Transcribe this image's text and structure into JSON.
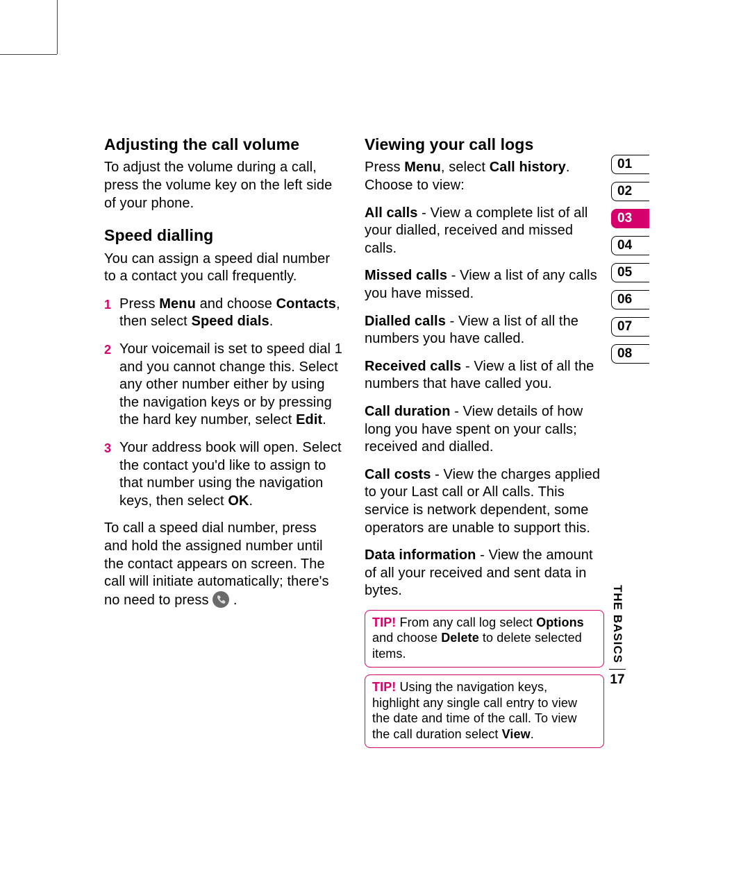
{
  "left": {
    "h1": "Adjusting the call volume",
    "p1": "To adjust the volume during a call, press the volume key on the left side of your phone.",
    "h2": "Speed dialling",
    "p2": "You can assign a speed dial number to a contact you call frequently.",
    "li1_a": "Press ",
    "li1_b": "Menu",
    "li1_c": " and choose ",
    "li1_d": "Contacts",
    "li1_e": ", then select ",
    "li1_f": "Speed dials",
    "li1_g": ".",
    "li2_a": "Your voicemail is set to speed dial 1 and you cannot change this. Select any other number either by using the navigation keys or by pressing the hard key number, select ",
    "li2_b": "Edit",
    "li2_c": ".",
    "li3_a": "Your address book will open. Select the contact you'd like to assign to that number using the navigation keys, then select ",
    "li3_b": "OK",
    "li3_c": ".",
    "p3_a": "To call a speed dial number, press and hold the assigned number until the contact appears on screen. The call will initiate automatically; there's no need to press ",
    "p3_b": " ."
  },
  "right": {
    "h1": "Viewing your call logs",
    "p1_a": "Press ",
    "p1_b": "Menu",
    "p1_c": ", select ",
    "p1_d": "Call history",
    "p1_e": ". Choose to view:",
    "p2_a": "All calls",
    "p2_b": " - View a complete list of all your dialled, received and missed calls.",
    "p3_a": "Missed calls",
    "p3_b": " - View a list of any calls you have missed.",
    "p4_a": "Dialled calls",
    "p4_b": " - View a list of all the numbers you have called.",
    "p5_a": "Received calls",
    "p5_b": " - View a list of all the numbers that have called you.",
    "p6_a": "Call duration",
    "p6_b": " - View details of how long you have spent on your calls; received and dialled.",
    "p7_a": "Call costs",
    "p7_b": " - View the charges applied to your Last call or All calls. This service is network dependent, some operators are unable to support this.",
    "p8_a": "Data information",
    "p8_b": " - View the amount of all your received and sent data in bytes.",
    "tip1_label": "TIP!",
    "tip1_a": " From any call log select ",
    "tip1_b": "Options",
    "tip1_c": " and choose ",
    "tip1_d": "Delete",
    "tip1_e": " to delete selected items.",
    "tip2_label": "TIP!",
    "tip2_a": " Using the navigation keys, highlight any single call entry to view the date and time of the call. To view the call duration select ",
    "tip2_b": "View",
    "tip2_c": "."
  },
  "tabs": [
    "01",
    "02",
    "03",
    "04",
    "05",
    "06",
    "07",
    "08"
  ],
  "active_tab": "03",
  "section_label": "THE BASICS",
  "page_num": "17",
  "nums": {
    "n1": "1",
    "n2": "2",
    "n3": "3"
  }
}
